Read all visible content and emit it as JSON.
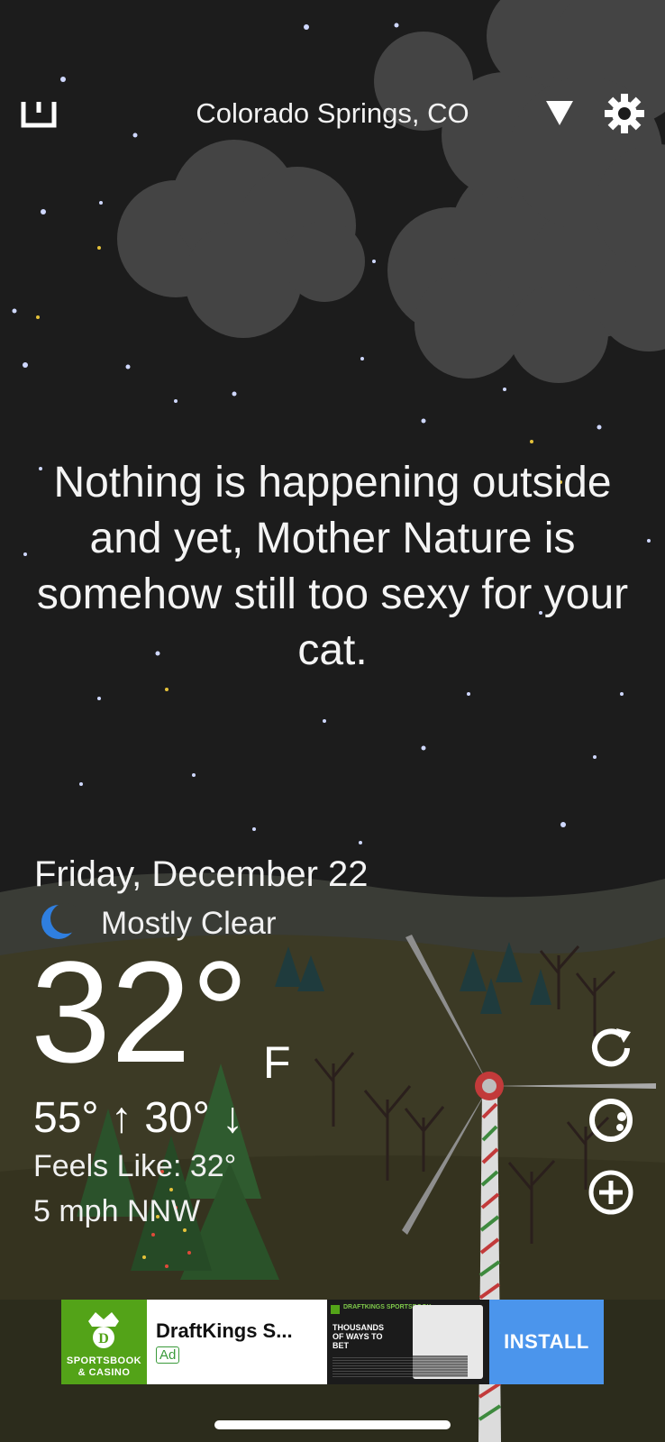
{
  "header": {
    "location": "Colorado Springs, CO",
    "icons": [
      "share-icon",
      "location-dropdown-icon",
      "settings-gear-icon"
    ]
  },
  "main": {
    "quote": "Nothing is happening outside and yet, Mother Nature is somehow still too sexy for your cat."
  },
  "weather": {
    "date": "Friday, December 22",
    "condition_icon": "moon-icon",
    "condition": "Mostly Clear",
    "temperature": "32°",
    "unit": "F",
    "high_low": "55° ↑ 30° ↓",
    "feels_like": "Feels Like: 32°",
    "wind": "5 mph NNW"
  },
  "side_actions": [
    "refresh-icon",
    "radar-icon",
    "add-location-icon"
  ],
  "ad": {
    "brand_logo_text": "SPORTSBOOK & CASINO",
    "title": "DraftKings S...",
    "badge": "Ad",
    "creative_brand": "DRAFTKINGS SPORTSBOOK",
    "creative_text": "THOUSANDS OF WAYS TO BET",
    "install_label": "INSTALL",
    "colors": {
      "logo_bg": "#53a318",
      "install_bg": "#4b95ec"
    }
  }
}
